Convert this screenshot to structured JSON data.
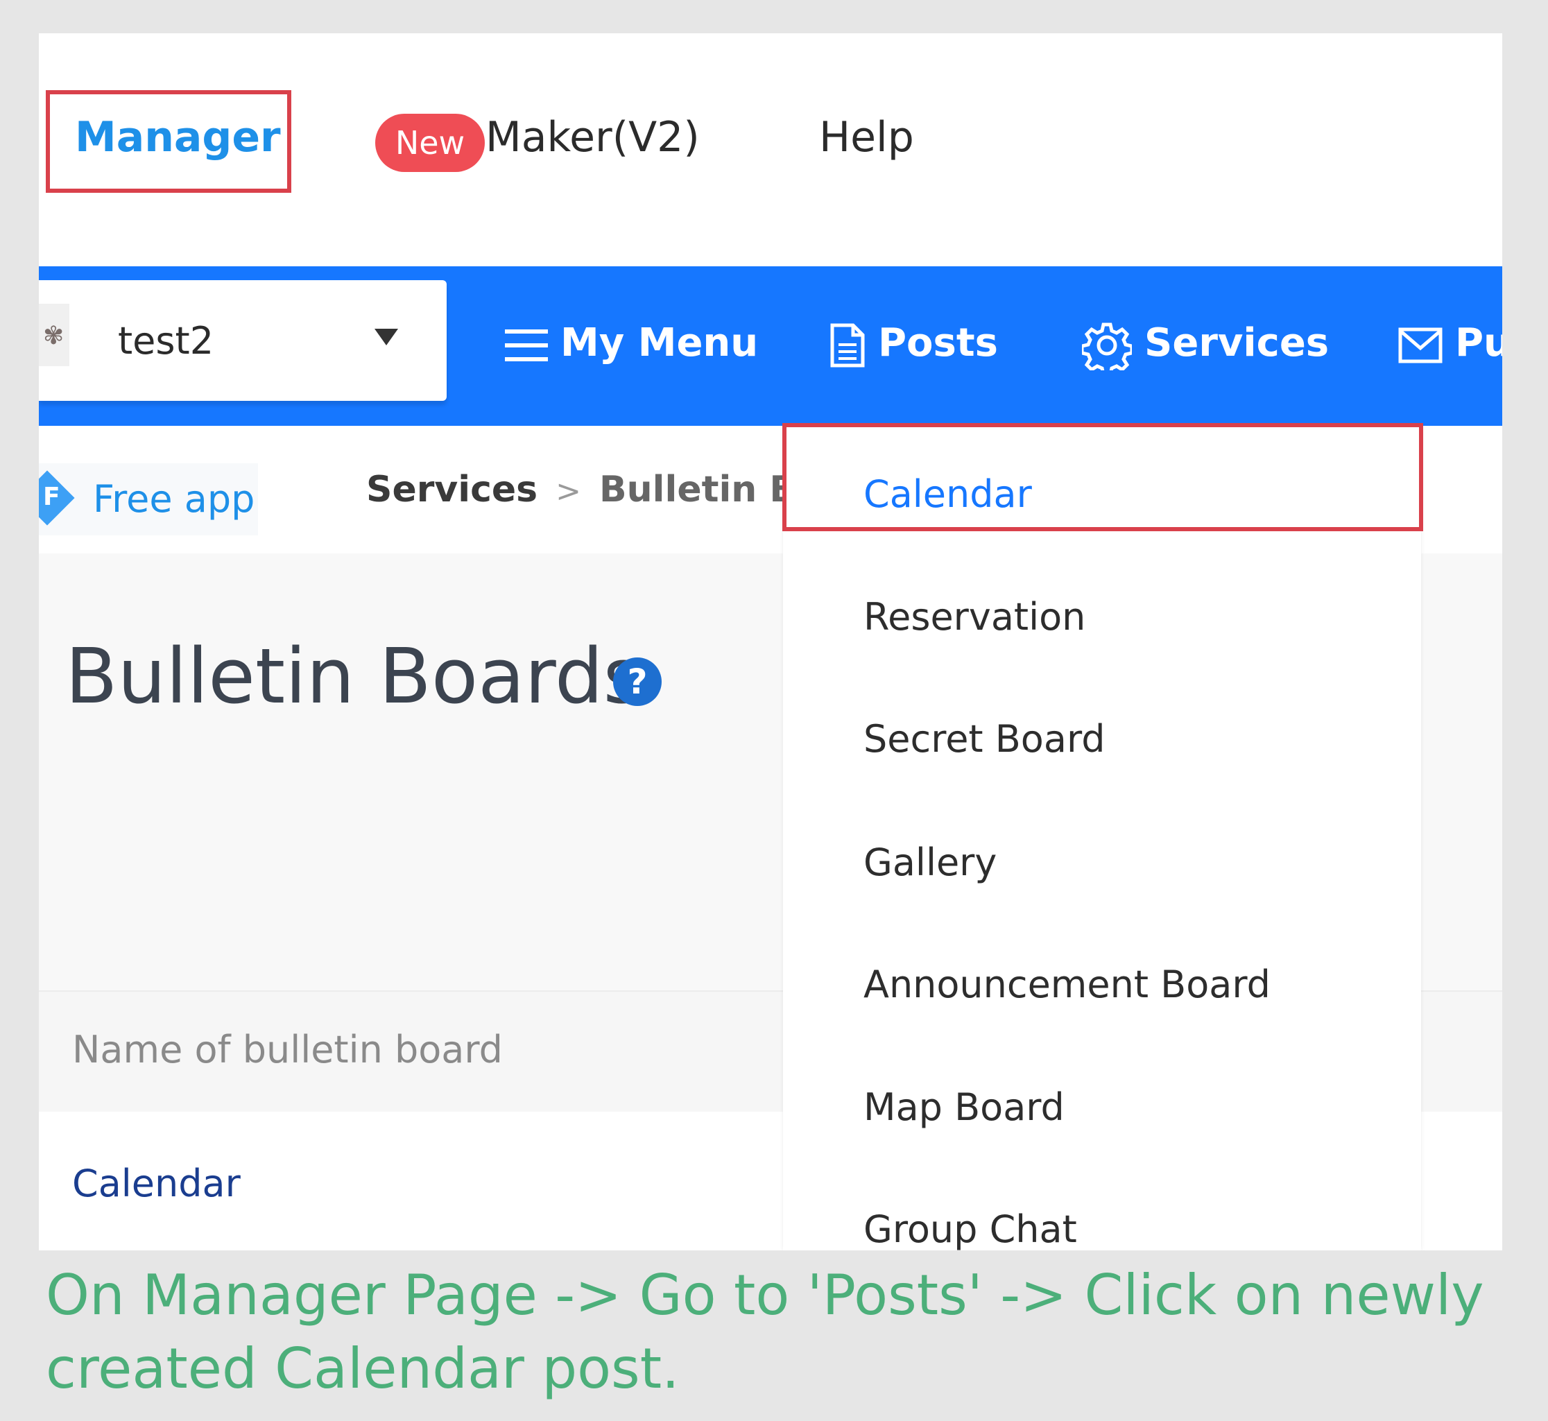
{
  "top_nav": {
    "manager": "Manager",
    "new_badge": "New",
    "maker": "Maker(V2)",
    "help": "Help"
  },
  "app_selector": {
    "value": "test2"
  },
  "main_nav": {
    "my_menu": "My Menu",
    "posts": "Posts",
    "services": "Services",
    "push_partial": "Pu"
  },
  "sub_bar": {
    "free_app_letter": "F",
    "free_app": "Free app",
    "breadcrumb": [
      "Services",
      ">",
      "Bulletin B"
    ]
  },
  "page": {
    "title": "Bulletin Boards",
    "help_symbol": "?"
  },
  "table": {
    "header": "Name of bulletin board",
    "rows": [
      "Calendar"
    ]
  },
  "dropdown": {
    "items": [
      "Calendar",
      "Reservation",
      "Secret Board",
      "Gallery",
      "Announcement Board",
      "Map Board",
      "Group Chat"
    ]
  },
  "caption": "On Manager Page -> Go to 'Posts' -> Click on newly created Calendar post.",
  "colors": {
    "brand_blue": "#1677ff",
    "highlight_red": "#d9414b",
    "caption_green": "#4caf7a"
  }
}
